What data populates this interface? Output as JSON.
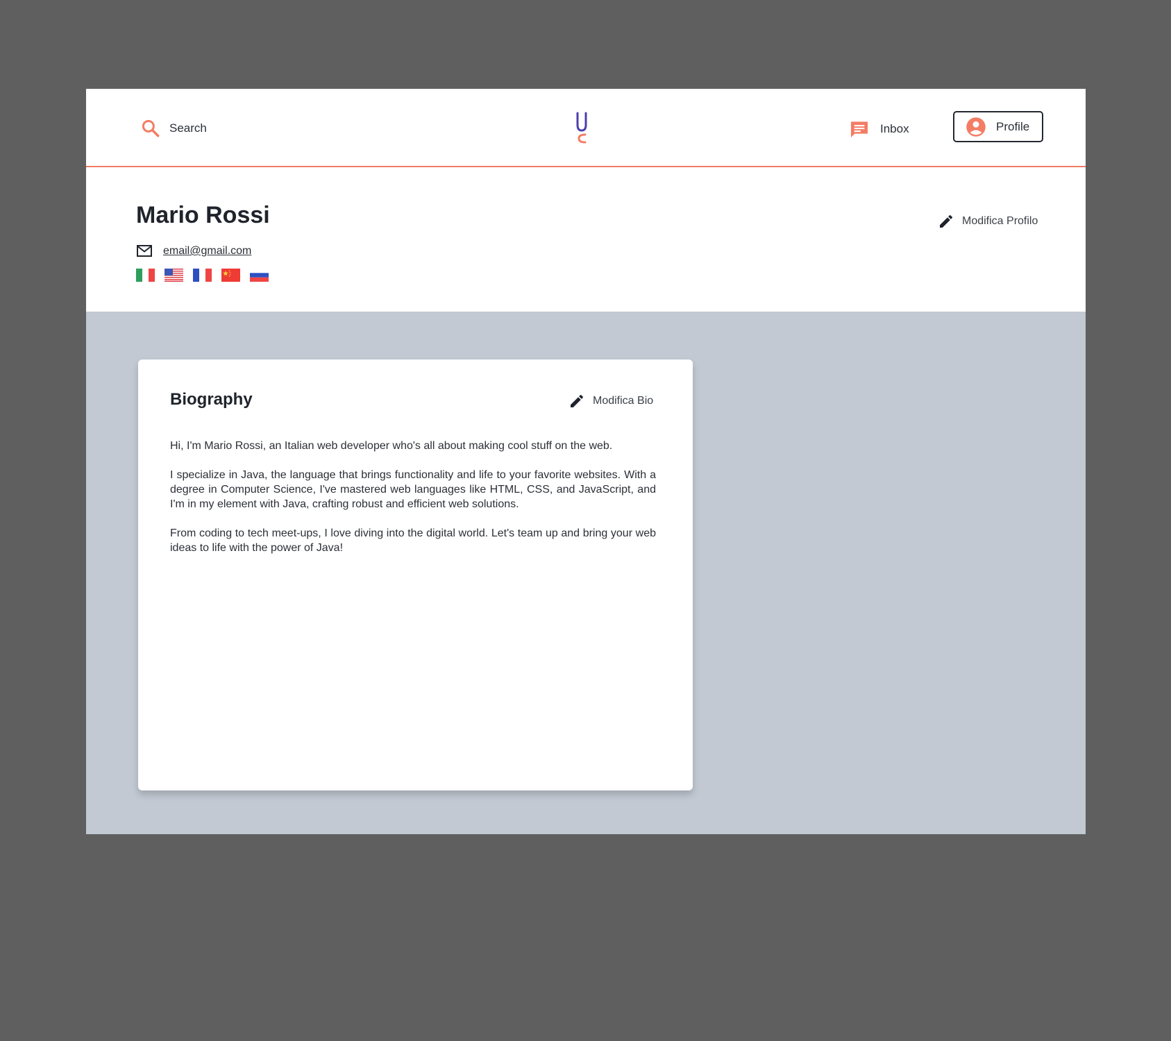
{
  "header": {
    "search_label": "Search",
    "inbox_label": "Inbox",
    "profile_label": "Profile",
    "logo_letter": "U",
    "accent_color": "#f47c64",
    "logo_color": "#4b3fae"
  },
  "profile": {
    "name": "Mario Rossi",
    "email": "email@gmail.com",
    "edit_label": "Modifica Profilo",
    "languages": [
      "it-flag",
      "us-flag",
      "fr-flag",
      "cn-flag",
      "ru-flag"
    ]
  },
  "biography": {
    "title": "Biography",
    "edit_label": "Modifica Bio",
    "paragraphs": [
      "Hi, I'm Mario Rossi, an Italian web developer who's all about making cool stuff on the web.",
      "I specialize in Java, the language that brings functionality and life to your favorite websites. With a degree in Computer Science, I've mastered web languages like HTML, CSS, and JavaScript, and I'm in my element with Java, crafting robust and efficient web solutions.",
      "From coding to tech meet-ups, I love diving into the digital world. Let's team up and bring your web ideas to life with the power of Java!"
    ]
  }
}
